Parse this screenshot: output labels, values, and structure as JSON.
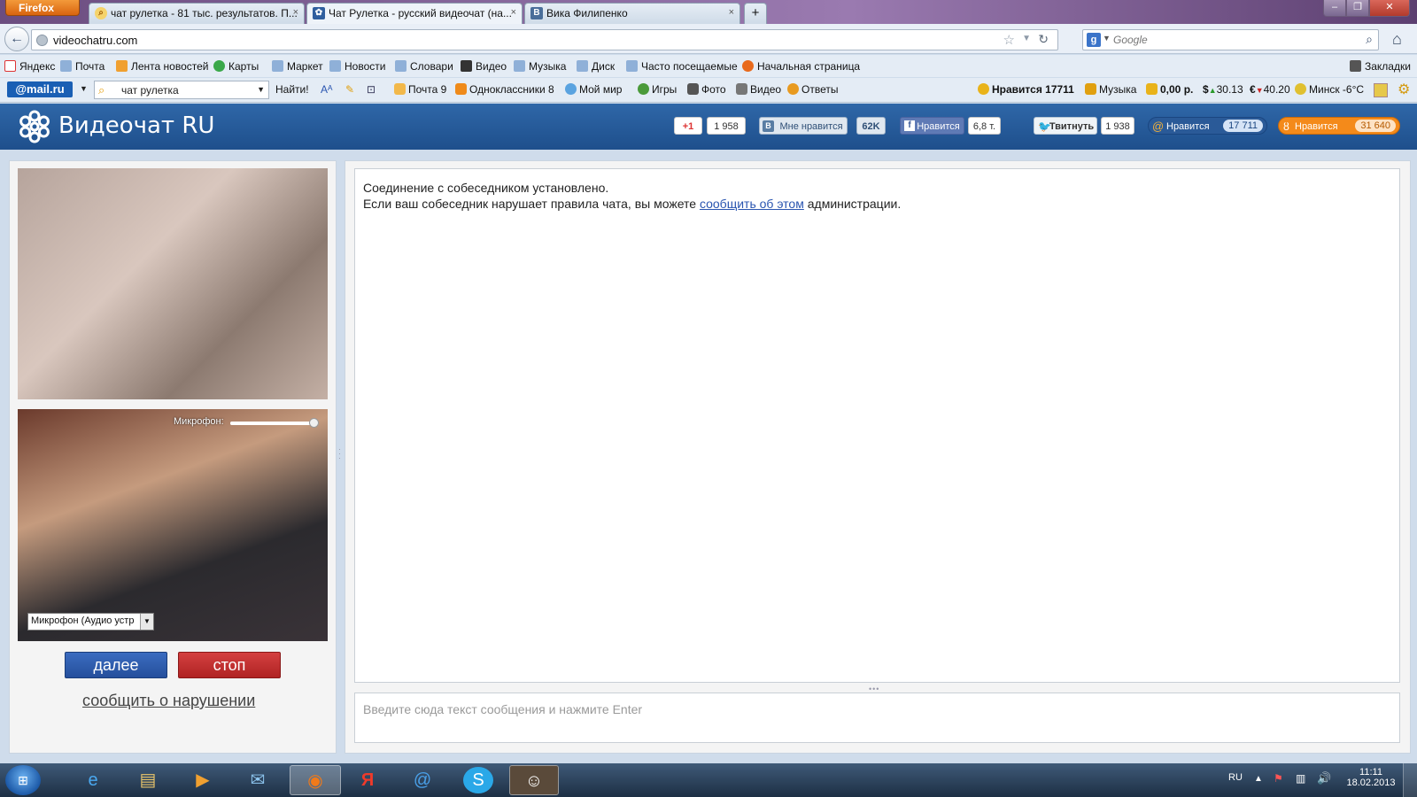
{
  "browser": {
    "menu_button": "Firefox",
    "tabs": [
      {
        "title": "чат рулетка - 81 тыс. результатов. П...",
        "icon": "search-icon"
      },
      {
        "title": "Чат Рулетка - русский видеочат (на...",
        "icon": "videochat-icon"
      },
      {
        "title": "Вика Филипенко",
        "icon": "vk-icon"
      }
    ],
    "new_tab": "+",
    "url": "videochatru.com",
    "search_placeholder": "Google"
  },
  "bookmarks": [
    "Яндекс",
    "Почта",
    "Лента новостей",
    "Карты",
    "Маркет",
    "Новости",
    "Словари",
    "Видео",
    "Музыка",
    "Диск",
    "Часто посещаемые",
    "Начальная страница"
  ],
  "bookmarks_right": "Закладки",
  "mail_toolbar": {
    "logo": "@mail.ru",
    "search_value": "чат рулетка",
    "find_label": "Найти!",
    "items": [
      "Почта 9",
      "Одноклассники 8",
      "Мой мир",
      "Игры",
      "Фото",
      "Видео",
      "Ответы"
    ],
    "likes": "Нравится 17711",
    "music": "Музыка",
    "balance": "0,00 р.",
    "usd": "30.13",
    "eur": "40.20",
    "weather": "Минск -6°C"
  },
  "site": {
    "logo_text": "Видеочат RU",
    "social": {
      "gplus_label": "+1",
      "gplus_count": "1 958",
      "vk_label": "Мне нравится",
      "vk_count": "62K",
      "fb_label": "Нравится",
      "fb_count": "6,8 т.",
      "tw_label": "Твитнуть",
      "tw_count": "1 938",
      "mail_label": "Нравится",
      "mail_count": "17 711",
      "ok_label": "Нравится",
      "ok_count": "31 640"
    }
  },
  "video": {
    "mic_label": "Микрофон:",
    "mic_level": 0.95,
    "mic_device": "Микрофон (Аудио устр"
  },
  "buttons": {
    "next": "далее",
    "stop": "стоп"
  },
  "report_link": "сообщить о нарушении",
  "chat": {
    "line1": "Соединение с собеседником установлено.",
    "line2_before": "Если ваш собеседник нарушает правила чата, вы можете ",
    "line2_link": "сообщить об этом",
    "line2_after": " администрации.",
    "input_placeholder": "Введите сюда текст сообщения и нажмите Enter"
  },
  "taskbar": {
    "language": "RU",
    "time": "11:11",
    "date": "18.02.2013"
  }
}
